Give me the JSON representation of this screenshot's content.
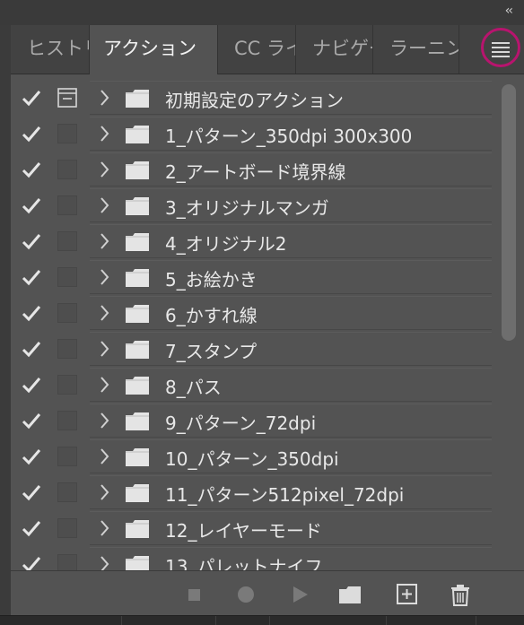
{
  "collapse_label": "‹‹",
  "tabs": [
    {
      "label": "ヒストリー",
      "active": false
    },
    {
      "label": "アクション",
      "active": true
    },
    {
      "label": "CC ライブラリ",
      "active": false
    },
    {
      "label": "ナビゲーター",
      "active": false
    },
    {
      "label": "ラーニング",
      "active": false
    }
  ],
  "actions": [
    {
      "name": "初期設定のアクション",
      "checked": true,
      "dialog_on": true
    },
    {
      "name": "1_パターン_350dpi  300x300",
      "checked": true,
      "dialog_on": false
    },
    {
      "name": "2_アートボード境界線",
      "checked": true,
      "dialog_on": false
    },
    {
      "name": "3_オリジナルマンガ",
      "checked": true,
      "dialog_on": false
    },
    {
      "name": "4_オリジナル2",
      "checked": true,
      "dialog_on": false
    },
    {
      "name": "5_お絵かき",
      "checked": true,
      "dialog_on": false
    },
    {
      "name": "6_かすれ線",
      "checked": true,
      "dialog_on": false
    },
    {
      "name": "7_スタンプ",
      "checked": true,
      "dialog_on": false
    },
    {
      "name": "8_パス",
      "checked": true,
      "dialog_on": false
    },
    {
      "name": "9_パターン_72dpi",
      "checked": true,
      "dialog_on": false
    },
    {
      "name": "10_パターン_350dpi",
      "checked": true,
      "dialog_on": false
    },
    {
      "name": "11_パターン512pixel_72dpi",
      "checked": true,
      "dialog_on": false
    },
    {
      "name": "12_レイヤーモード",
      "checked": true,
      "dialog_on": false
    },
    {
      "name": "13_パレットナイフ",
      "checked": true,
      "dialog_on": false
    }
  ],
  "bottom_buttons": [
    {
      "name": "stop-icon",
      "enabled": false
    },
    {
      "name": "record-icon",
      "enabled": false
    },
    {
      "name": "play-icon",
      "enabled": false
    },
    {
      "name": "new-set-icon",
      "enabled": true
    },
    {
      "name": "new-action-icon",
      "enabled": true
    },
    {
      "name": "trash-icon",
      "enabled": true
    }
  ],
  "colors": {
    "highlight_ring": "#b8146e",
    "panel_bg": "#535353"
  }
}
